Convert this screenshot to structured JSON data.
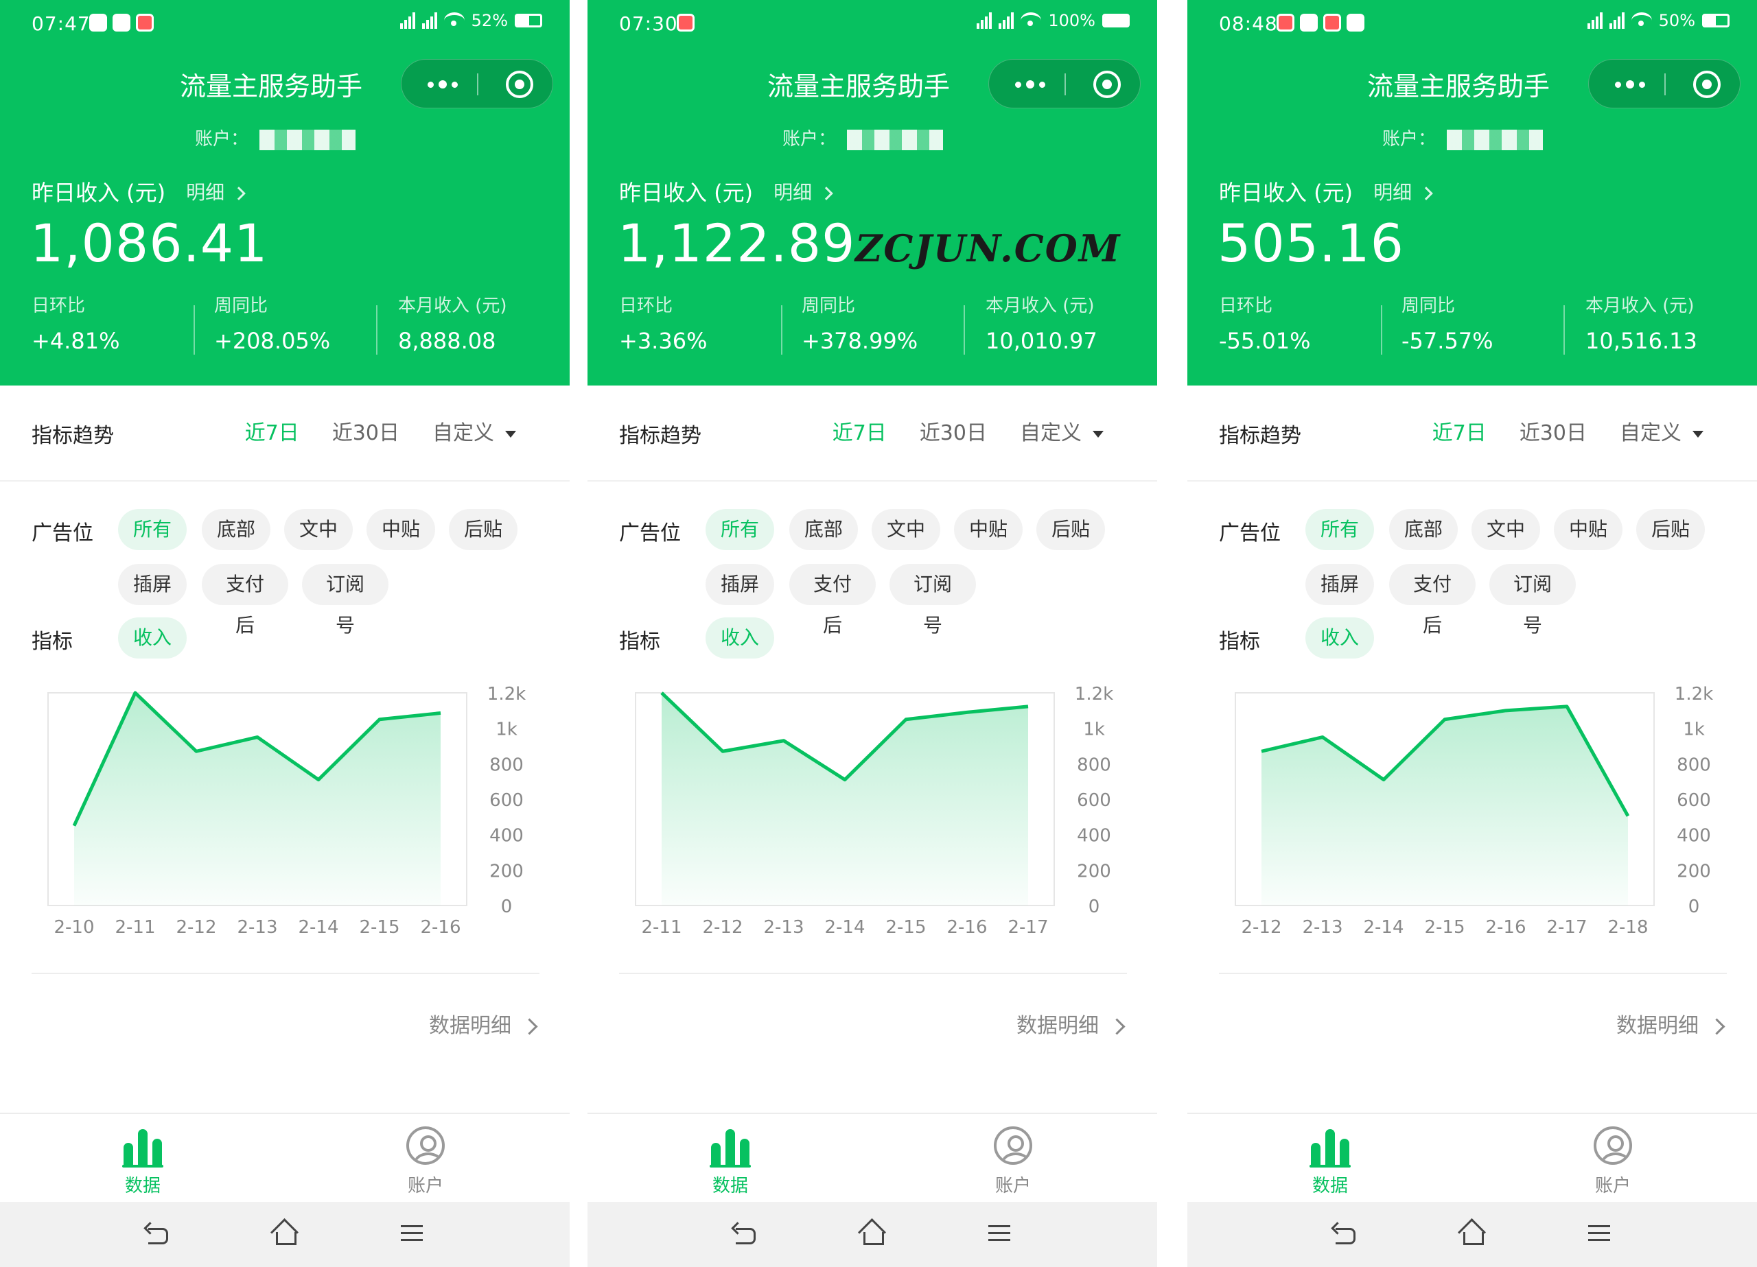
{
  "colors": {
    "brand_green": "#07c160",
    "chip_active_bg": "#e6f7ee",
    "chip_bg": "#f2f2f2",
    "text_dark": "#222222",
    "text_gray": "#888888"
  },
  "watermark": "ZCJUN.COM",
  "phones": [
    {
      "status": {
        "time": "07:47",
        "battery": "52%",
        "battery_level": 0.52
      },
      "nav_title": "流量主服务助手",
      "account_label": "账户：",
      "income": {
        "label": "昨日收入 (元)",
        "detail": "明细",
        "value": "1,086.41"
      },
      "stats": [
        {
          "label": "日环比",
          "value": "+4.81%"
        },
        {
          "label": "周同比",
          "value": "+208.05%"
        },
        {
          "label": "本月收入 (元)",
          "value": "8,888.08"
        }
      ],
      "trend": {
        "title": "指标趋势",
        "tabs": [
          "近7日",
          "近30日",
          "自定义"
        ],
        "active_tab": 0
      },
      "ad_slot": {
        "label": "广告位",
        "chips": [
          "所有",
          "底部",
          "文中",
          "中贴",
          "后贴",
          "插屏",
          "支付后",
          "订阅号"
        ],
        "active": 0
      },
      "metric": {
        "label": "指标",
        "chips": [
          "收入"
        ],
        "active": 0
      },
      "data_detail": "数据明细",
      "tabbar": {
        "items": [
          "数据",
          "账户"
        ],
        "active": 0
      }
    },
    {
      "status": {
        "time": "07:30",
        "battery": "100%",
        "battery_level": 1.0
      },
      "nav_title": "流量主服务助手",
      "account_label": "账户：",
      "income": {
        "label": "昨日收入 (元)",
        "detail": "明细",
        "value": "1,122.89"
      },
      "stats": [
        {
          "label": "日环比",
          "value": "+3.36%"
        },
        {
          "label": "周同比",
          "value": "+378.99%"
        },
        {
          "label": "本月收入 (元)",
          "value": "10,010.97"
        }
      ],
      "trend": {
        "title": "指标趋势",
        "tabs": [
          "近7日",
          "近30日",
          "自定义"
        ],
        "active_tab": 0
      },
      "ad_slot": {
        "label": "广告位",
        "chips": [
          "所有",
          "底部",
          "文中",
          "中贴",
          "后贴",
          "插屏",
          "支付后",
          "订阅号"
        ],
        "active": 0
      },
      "metric": {
        "label": "指标",
        "chips": [
          "收入"
        ],
        "active": 0
      },
      "data_detail": "数据明细",
      "tabbar": {
        "items": [
          "数据",
          "账户"
        ],
        "active": 0
      }
    },
    {
      "status": {
        "time": "08:48",
        "battery": "50%",
        "battery_level": 0.5
      },
      "nav_title": "流量主服务助手",
      "account_label": "账户：",
      "income": {
        "label": "昨日收入 (元)",
        "detail": "明细",
        "value": "505.16"
      },
      "stats": [
        {
          "label": "日环比",
          "value": "-55.01%"
        },
        {
          "label": "周同比",
          "value": "-57.57%"
        },
        {
          "label": "本月收入 (元)",
          "value": "10,516.13"
        }
      ],
      "trend": {
        "title": "指标趋势",
        "tabs": [
          "近7日",
          "近30日",
          "自定义"
        ],
        "active_tab": 0
      },
      "ad_slot": {
        "label": "广告位",
        "chips": [
          "所有",
          "底部",
          "文中",
          "中贴",
          "后贴",
          "插屏",
          "支付后",
          "订阅号"
        ],
        "active": 0
      },
      "metric": {
        "label": "指标",
        "chips": [
          "收入"
        ],
        "active": 0
      },
      "data_detail": "数据明细",
      "tabbar": {
        "items": [
          "数据",
          "账户"
        ],
        "active": 0
      }
    }
  ],
  "chart_data": [
    {
      "type": "area",
      "categories": [
        "2-10",
        "2-11",
        "2-12",
        "2-13",
        "2-14",
        "2-15",
        "2-16"
      ],
      "values": [
        450,
        1200,
        870,
        950,
        710,
        1050,
        1086
      ],
      "yticks": [
        "1.2k",
        "1k",
        "800",
        "600",
        "400",
        "200",
        "0"
      ],
      "ylim": [
        0,
        1200
      ],
      "color": "#07c160"
    },
    {
      "type": "area",
      "categories": [
        "2-11",
        "2-12",
        "2-13",
        "2-14",
        "2-15",
        "2-16",
        "2-17"
      ],
      "values": [
        1200,
        870,
        930,
        710,
        1050,
        1090,
        1123
      ],
      "yticks": [
        "1.2k",
        "1k",
        "800",
        "600",
        "400",
        "200",
        "0"
      ],
      "ylim": [
        0,
        1200
      ],
      "color": "#07c160"
    },
    {
      "type": "area",
      "categories": [
        "2-12",
        "2-13",
        "2-14",
        "2-15",
        "2-16",
        "2-17",
        "2-18"
      ],
      "values": [
        870,
        950,
        710,
        1050,
        1100,
        1123,
        505
      ],
      "yticks": [
        "1.2k",
        "1k",
        "800",
        "600",
        "400",
        "200",
        "0"
      ],
      "ylim": [
        0,
        1200
      ],
      "color": "#07c160"
    }
  ]
}
